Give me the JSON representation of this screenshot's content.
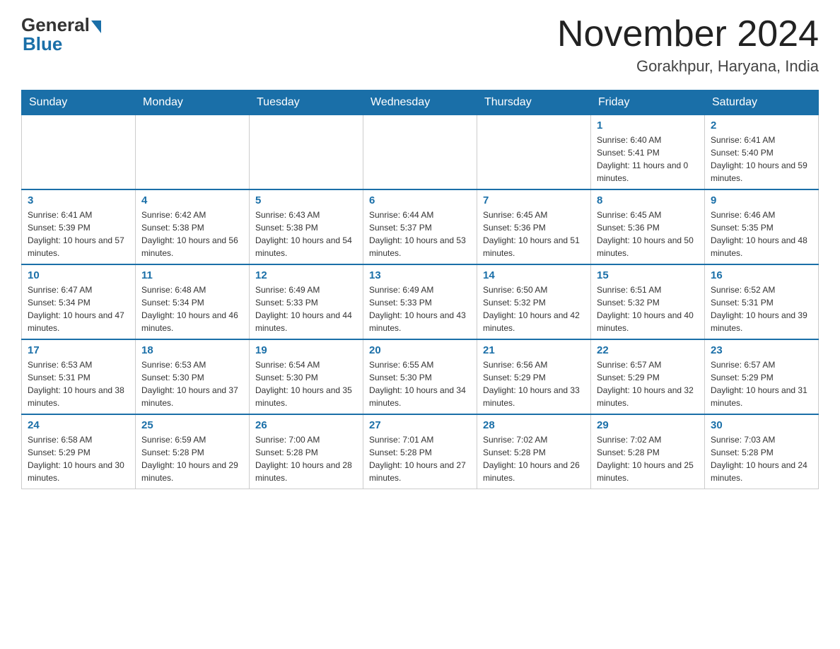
{
  "header": {
    "logo_text": "General",
    "logo_blue": "Blue",
    "month_title": "November 2024",
    "location": "Gorakhpur, Haryana, India"
  },
  "weekdays": [
    "Sunday",
    "Monday",
    "Tuesday",
    "Wednesday",
    "Thursday",
    "Friday",
    "Saturday"
  ],
  "weeks": [
    [
      {
        "day": "",
        "info": ""
      },
      {
        "day": "",
        "info": ""
      },
      {
        "day": "",
        "info": ""
      },
      {
        "day": "",
        "info": ""
      },
      {
        "day": "",
        "info": ""
      },
      {
        "day": "1",
        "info": "Sunrise: 6:40 AM\nSunset: 5:41 PM\nDaylight: 11 hours and 0 minutes."
      },
      {
        "day": "2",
        "info": "Sunrise: 6:41 AM\nSunset: 5:40 PM\nDaylight: 10 hours and 59 minutes."
      }
    ],
    [
      {
        "day": "3",
        "info": "Sunrise: 6:41 AM\nSunset: 5:39 PM\nDaylight: 10 hours and 57 minutes."
      },
      {
        "day": "4",
        "info": "Sunrise: 6:42 AM\nSunset: 5:38 PM\nDaylight: 10 hours and 56 minutes."
      },
      {
        "day": "5",
        "info": "Sunrise: 6:43 AM\nSunset: 5:38 PM\nDaylight: 10 hours and 54 minutes."
      },
      {
        "day": "6",
        "info": "Sunrise: 6:44 AM\nSunset: 5:37 PM\nDaylight: 10 hours and 53 minutes."
      },
      {
        "day": "7",
        "info": "Sunrise: 6:45 AM\nSunset: 5:36 PM\nDaylight: 10 hours and 51 minutes."
      },
      {
        "day": "8",
        "info": "Sunrise: 6:45 AM\nSunset: 5:36 PM\nDaylight: 10 hours and 50 minutes."
      },
      {
        "day": "9",
        "info": "Sunrise: 6:46 AM\nSunset: 5:35 PM\nDaylight: 10 hours and 48 minutes."
      }
    ],
    [
      {
        "day": "10",
        "info": "Sunrise: 6:47 AM\nSunset: 5:34 PM\nDaylight: 10 hours and 47 minutes."
      },
      {
        "day": "11",
        "info": "Sunrise: 6:48 AM\nSunset: 5:34 PM\nDaylight: 10 hours and 46 minutes."
      },
      {
        "day": "12",
        "info": "Sunrise: 6:49 AM\nSunset: 5:33 PM\nDaylight: 10 hours and 44 minutes."
      },
      {
        "day": "13",
        "info": "Sunrise: 6:49 AM\nSunset: 5:33 PM\nDaylight: 10 hours and 43 minutes."
      },
      {
        "day": "14",
        "info": "Sunrise: 6:50 AM\nSunset: 5:32 PM\nDaylight: 10 hours and 42 minutes."
      },
      {
        "day": "15",
        "info": "Sunrise: 6:51 AM\nSunset: 5:32 PM\nDaylight: 10 hours and 40 minutes."
      },
      {
        "day": "16",
        "info": "Sunrise: 6:52 AM\nSunset: 5:31 PM\nDaylight: 10 hours and 39 minutes."
      }
    ],
    [
      {
        "day": "17",
        "info": "Sunrise: 6:53 AM\nSunset: 5:31 PM\nDaylight: 10 hours and 38 minutes."
      },
      {
        "day": "18",
        "info": "Sunrise: 6:53 AM\nSunset: 5:30 PM\nDaylight: 10 hours and 37 minutes."
      },
      {
        "day": "19",
        "info": "Sunrise: 6:54 AM\nSunset: 5:30 PM\nDaylight: 10 hours and 35 minutes."
      },
      {
        "day": "20",
        "info": "Sunrise: 6:55 AM\nSunset: 5:30 PM\nDaylight: 10 hours and 34 minutes."
      },
      {
        "day": "21",
        "info": "Sunrise: 6:56 AM\nSunset: 5:29 PM\nDaylight: 10 hours and 33 minutes."
      },
      {
        "day": "22",
        "info": "Sunrise: 6:57 AM\nSunset: 5:29 PM\nDaylight: 10 hours and 32 minutes."
      },
      {
        "day": "23",
        "info": "Sunrise: 6:57 AM\nSunset: 5:29 PM\nDaylight: 10 hours and 31 minutes."
      }
    ],
    [
      {
        "day": "24",
        "info": "Sunrise: 6:58 AM\nSunset: 5:29 PM\nDaylight: 10 hours and 30 minutes."
      },
      {
        "day": "25",
        "info": "Sunrise: 6:59 AM\nSunset: 5:28 PM\nDaylight: 10 hours and 29 minutes."
      },
      {
        "day": "26",
        "info": "Sunrise: 7:00 AM\nSunset: 5:28 PM\nDaylight: 10 hours and 28 minutes."
      },
      {
        "day": "27",
        "info": "Sunrise: 7:01 AM\nSunset: 5:28 PM\nDaylight: 10 hours and 27 minutes."
      },
      {
        "day": "28",
        "info": "Sunrise: 7:02 AM\nSunset: 5:28 PM\nDaylight: 10 hours and 26 minutes."
      },
      {
        "day": "29",
        "info": "Sunrise: 7:02 AM\nSunset: 5:28 PM\nDaylight: 10 hours and 25 minutes."
      },
      {
        "day": "30",
        "info": "Sunrise: 7:03 AM\nSunset: 5:28 PM\nDaylight: 10 hours and 24 minutes."
      }
    ]
  ]
}
